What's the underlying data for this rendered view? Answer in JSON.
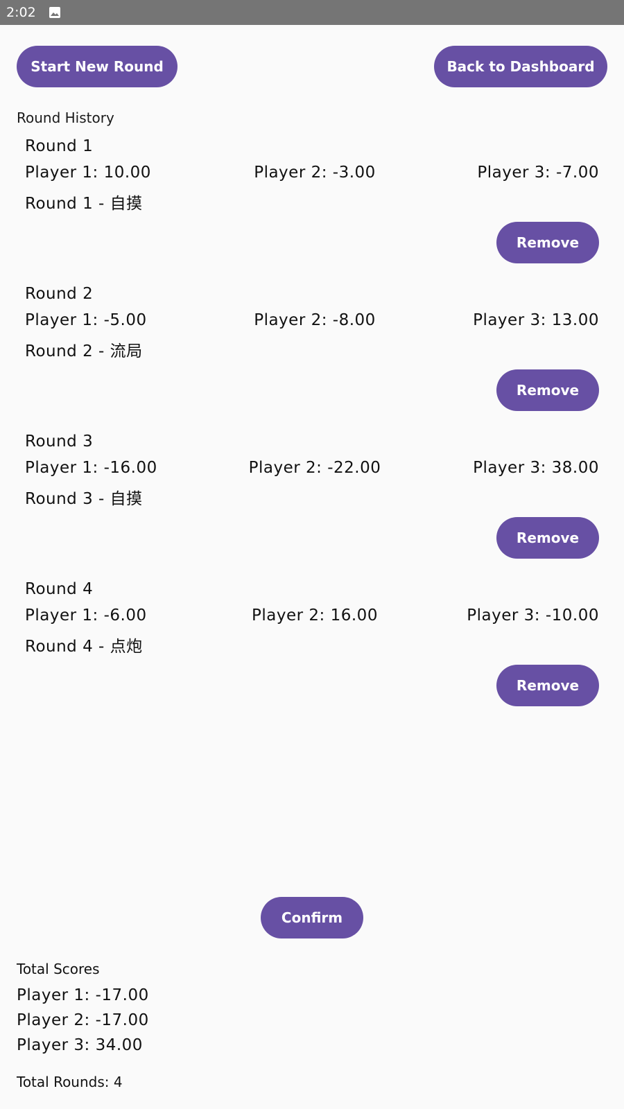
{
  "status_bar": {
    "time": "2:02",
    "icon": "image-icon"
  },
  "toolbar": {
    "start_label": "Start New Round",
    "back_label": "Back to Dashboard"
  },
  "history": {
    "label": "Round History",
    "rounds": [
      {
        "title": "Round 1",
        "scores": [
          "Player 1: 10.00",
          "Player 2: -3.00",
          "Player 3: -7.00"
        ],
        "note": "Round 1 - 自摸",
        "remove_label": "Remove"
      },
      {
        "title": "Round 2",
        "scores": [
          "Player 1: -5.00",
          "Player 2: -8.00",
          "Player 3: 13.00"
        ],
        "note": "Round 2 - 流局",
        "remove_label": "Remove"
      },
      {
        "title": "Round 3",
        "scores": [
          "Player 1: -16.00",
          "Player 2: -22.00",
          "Player 3: 38.00"
        ],
        "note": "Round 3 - 自摸",
        "remove_label": "Remove"
      },
      {
        "title": "Round 4",
        "scores": [
          "Player 1: -6.00",
          "Player 2: 16.00",
          "Player 3: -10.00"
        ],
        "note": "Round 4 - 点炮",
        "remove_label": "Remove"
      }
    ]
  },
  "confirm_label": "Confirm",
  "totals": {
    "label": "Total Scores",
    "lines": [
      "Player 1: -17.00",
      "Player 2: -17.00",
      "Player 3: 34.00"
    ],
    "rounds_label": "Total Rounds: 4"
  },
  "colors": {
    "accent": "#6750a4",
    "status_bar": "#757575",
    "background": "#fafafa"
  }
}
